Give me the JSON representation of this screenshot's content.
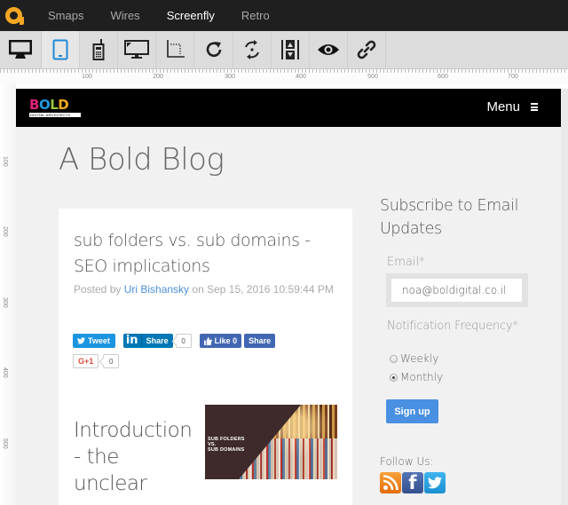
{
  "topnav": {
    "logo": "a-logo-icon",
    "items": [
      {
        "label": "Smaps",
        "active": false
      },
      {
        "label": "Wires",
        "active": false
      },
      {
        "label": "Screenfly",
        "active": true
      },
      {
        "label": "Retro",
        "active": false
      }
    ]
  },
  "toolbar": {
    "buttons": [
      {
        "icon": "desktop-icon",
        "active": false
      },
      {
        "icon": "tablet-icon",
        "active": true
      },
      {
        "icon": "mobile-phone-icon",
        "active": false
      },
      {
        "icon": "television-icon",
        "active": false
      },
      {
        "icon": "custom-size-icon",
        "active": false
      },
      {
        "icon": "rotate-icon",
        "active": false
      },
      {
        "icon": "scroll-toggle-icon",
        "active": false
      },
      {
        "icon": "scrollbar-icon",
        "active": false
      },
      {
        "icon": "preview-eye-icon",
        "active": false
      },
      {
        "icon": "share-link-icon",
        "active": false
      }
    ]
  },
  "rulers": {
    "horizontal": [
      "100",
      "200",
      "300",
      "400",
      "500",
      "600",
      "700"
    ],
    "vertical": [
      "100",
      "200",
      "300",
      "400",
      "500"
    ]
  },
  "site": {
    "brand": {
      "letters": [
        "B",
        "O",
        "L",
        "D"
      ],
      "letter_colors": [
        "#e0207a",
        "#1e9be0",
        "#9bc43a",
        "#f5a623"
      ],
      "tagline": "DIGITAL ARCHITECTS"
    },
    "menu_label": "Menu",
    "blog_title": "A Bold Blog",
    "post": {
      "title": "sub folders vs. sub domains - SEO implications",
      "posted_by_prefix": "Posted by ",
      "author": "Uri Bishansky",
      "date_text": " on Sep 15, 2016 10:59:44 PM",
      "share": {
        "tweet_label": "Tweet",
        "linkedin_label": "Share",
        "linkedin_count": "0",
        "fb_like_label": "Like 0",
        "fb_share_label": "Share",
        "gplus_label": "G+1",
        "gplus_count": "0"
      },
      "intro_heading": "Introduction - the unclear",
      "image_text": [
        "SUB FOLDERS",
        "VS.",
        "SUB DOMAINS"
      ]
    },
    "sidebar": {
      "title": "Subscribe to Email Updates",
      "email_label": "Email*",
      "email_value": "noa@boldigital.co.il",
      "frequency_label": "Notification Frequency*",
      "options": [
        {
          "label": "Weekly",
          "checked": false
        },
        {
          "label": "Monthly",
          "checked": true
        }
      ],
      "signup_label": "Sign up",
      "follow_label": "Follow Us:",
      "social": [
        "rss-icon",
        "facebook-icon",
        "twitter-icon"
      ]
    }
  },
  "colors": {
    "accent_orange": "#f5a623",
    "active_blue": "#1e88d6",
    "link_blue": "#4a90d9",
    "signup_blue": "#4a90e2"
  }
}
